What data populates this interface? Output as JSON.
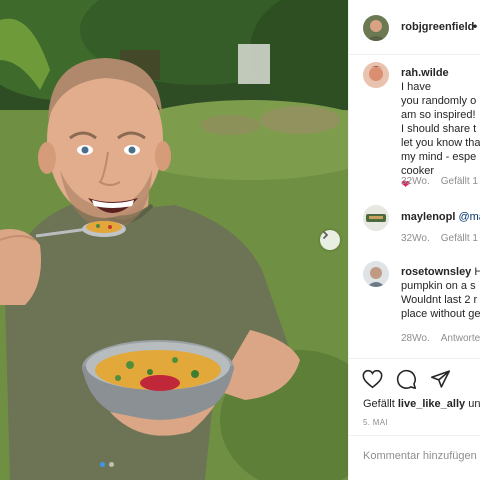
{
  "post": {
    "author": "robjgreenfield",
    "author_sep": "•",
    "carousel": {
      "total_dots": 2,
      "active_dot": 1
    }
  },
  "comments": [
    {
      "username": "rah.wilde",
      "text": "I have\nyou randomly o\nam so inspired!\nI should share t\nlet you know tha\nmy mind - espe\ncooker",
      "emoji": "❤",
      "age": "32Wo.",
      "likes": "Gefällt 1"
    },
    {
      "username": "maylenopl",
      "mention": "@ma",
      "age": "32Wo.",
      "likes": "Gefällt 1"
    },
    {
      "username": "rosetownsley",
      "text_first": "H",
      "text": "pumpkin on a s\nWouldnt last 2 r\nplace without ge",
      "age": "28Wo.",
      "reply": "Antworte"
    }
  ],
  "likes_line": {
    "prefix": "Gefällt",
    "user": "live_like_ally",
    "suffix": "und"
  },
  "date": "5. MAI",
  "comment_input": {
    "placeholder": "Kommentar hinzufügen"
  },
  "icons": {
    "like": "heart-icon",
    "comment": "comment-icon",
    "share": "share-icon",
    "next": "chevron-right-icon"
  },
  "colors": {
    "accent": "#3897f0",
    "heart": "#e0245e",
    "muted": "#8e8e8e"
  }
}
